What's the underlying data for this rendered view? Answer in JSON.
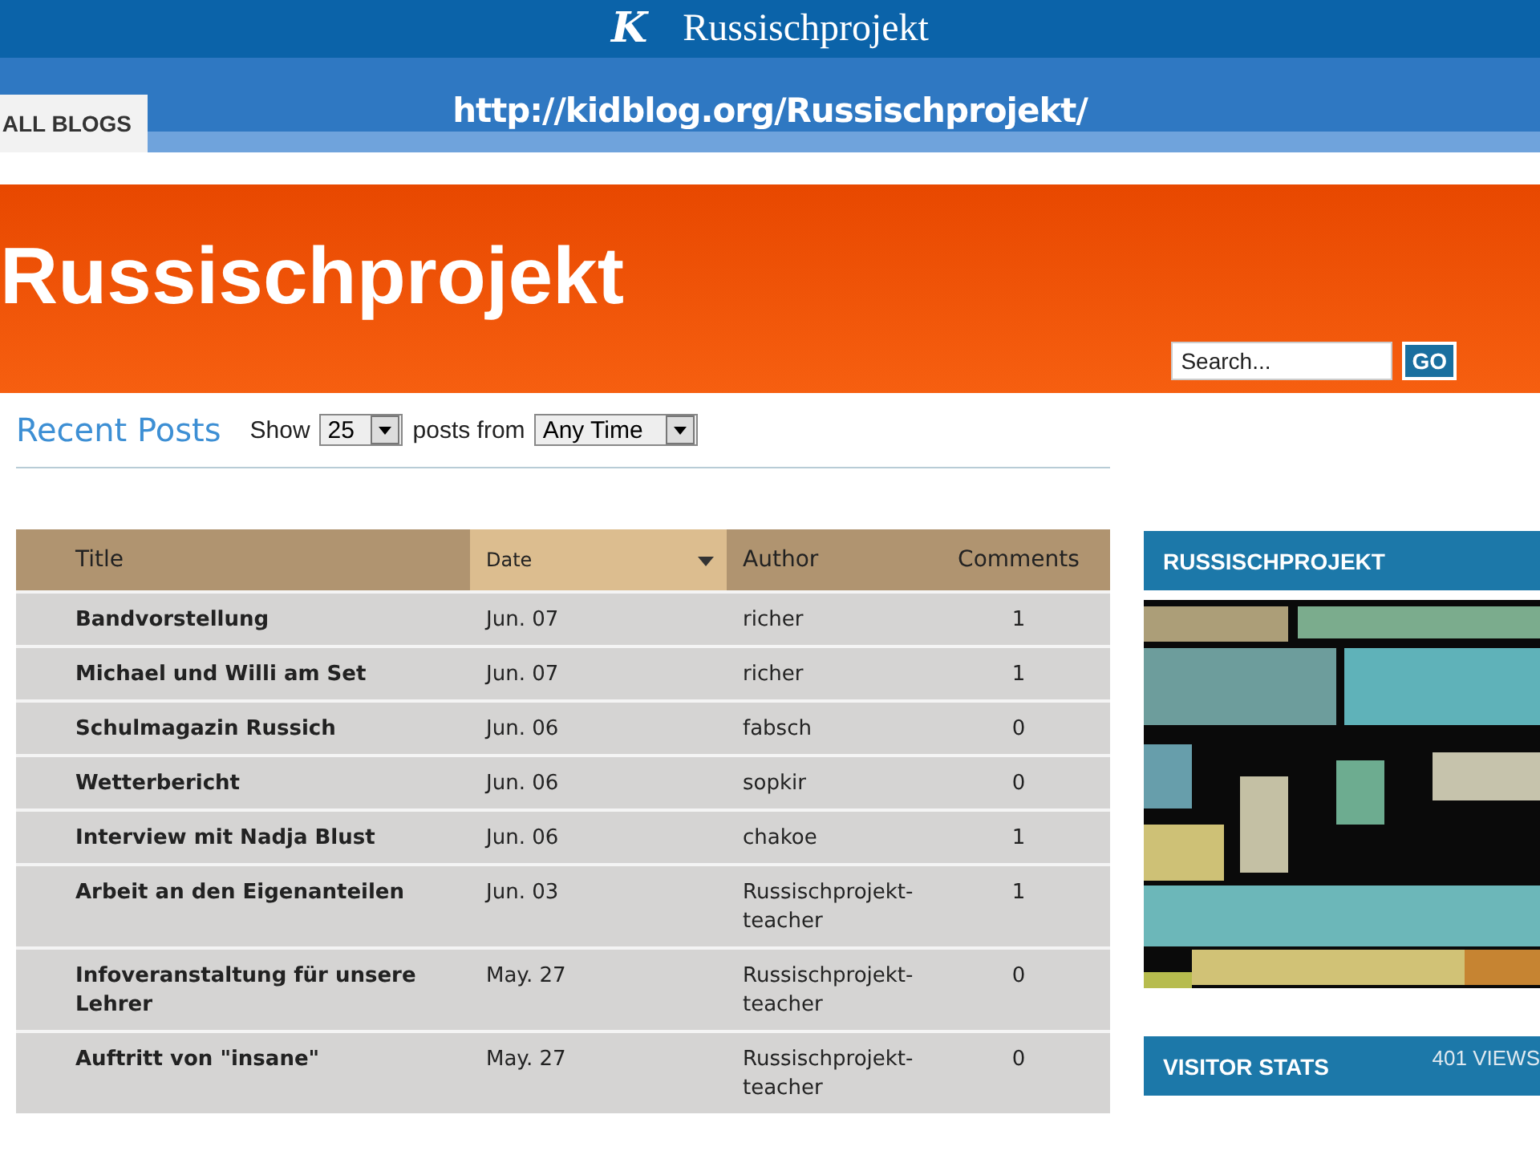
{
  "top_bar": {
    "logo_letter": "K",
    "title": "Russischprojekt"
  },
  "nav": {
    "tab": "ALL BLOGS",
    "url": "http://kidblog.org/Russischprojekt/"
  },
  "banner": {
    "title": "Russischprojekt",
    "search": {
      "placeholder": "Search..."
    },
    "go_button": "GO"
  },
  "filter": {
    "heading": "Recent Posts",
    "show_label": "Show",
    "count": "25",
    "posts_from_label": "posts from",
    "period": "Any Time"
  },
  "table": {
    "columns": [
      {
        "label": "Title",
        "sorted": false
      },
      {
        "label": "Date",
        "sorted": true
      },
      {
        "label": "Author",
        "sorted": false
      },
      {
        "label": "Comments",
        "sorted": false
      }
    ],
    "rows": [
      {
        "title": "Bandvorstellung",
        "date": "Jun. 07",
        "author": "richer",
        "comments": "1"
      },
      {
        "title": "Michael und Willi am Set",
        "date": "Jun. 07",
        "author": "richer",
        "comments": "1"
      },
      {
        "title": "Schulmagazin Russich",
        "date": "Jun. 06",
        "author": "fabsch",
        "comments": "0"
      },
      {
        "title": "Wetterbericht",
        "date": "Jun. 06",
        "author": "sopkir",
        "comments": "0"
      },
      {
        "title": "Interview mit Nadja Blust",
        "date": "Jun. 06",
        "author": "chakoe",
        "comments": "1"
      },
      {
        "title": "Arbeit an den Eigenanteilen",
        "date": "Jun. 03",
        "author": "Russischprojekt-teacher",
        "comments": "1"
      },
      {
        "title": "Infoveranstaltung für unsere Lehrer",
        "date": "May. 27",
        "author": "Russischprojekt-teacher",
        "comments": "0"
      },
      {
        "title": "Auftritt von \"insane\"",
        "date": "May. 27",
        "author": "Russischprojekt-teacher",
        "comments": "0"
      }
    ]
  },
  "sidebar": {
    "widgets": [
      {
        "kind": "picture",
        "title": "RUSSISCHPROJEKT"
      },
      {
        "kind": "stats",
        "title": "VISITOR STATS",
        "count": "401 VIEWS"
      }
    ]
  }
}
